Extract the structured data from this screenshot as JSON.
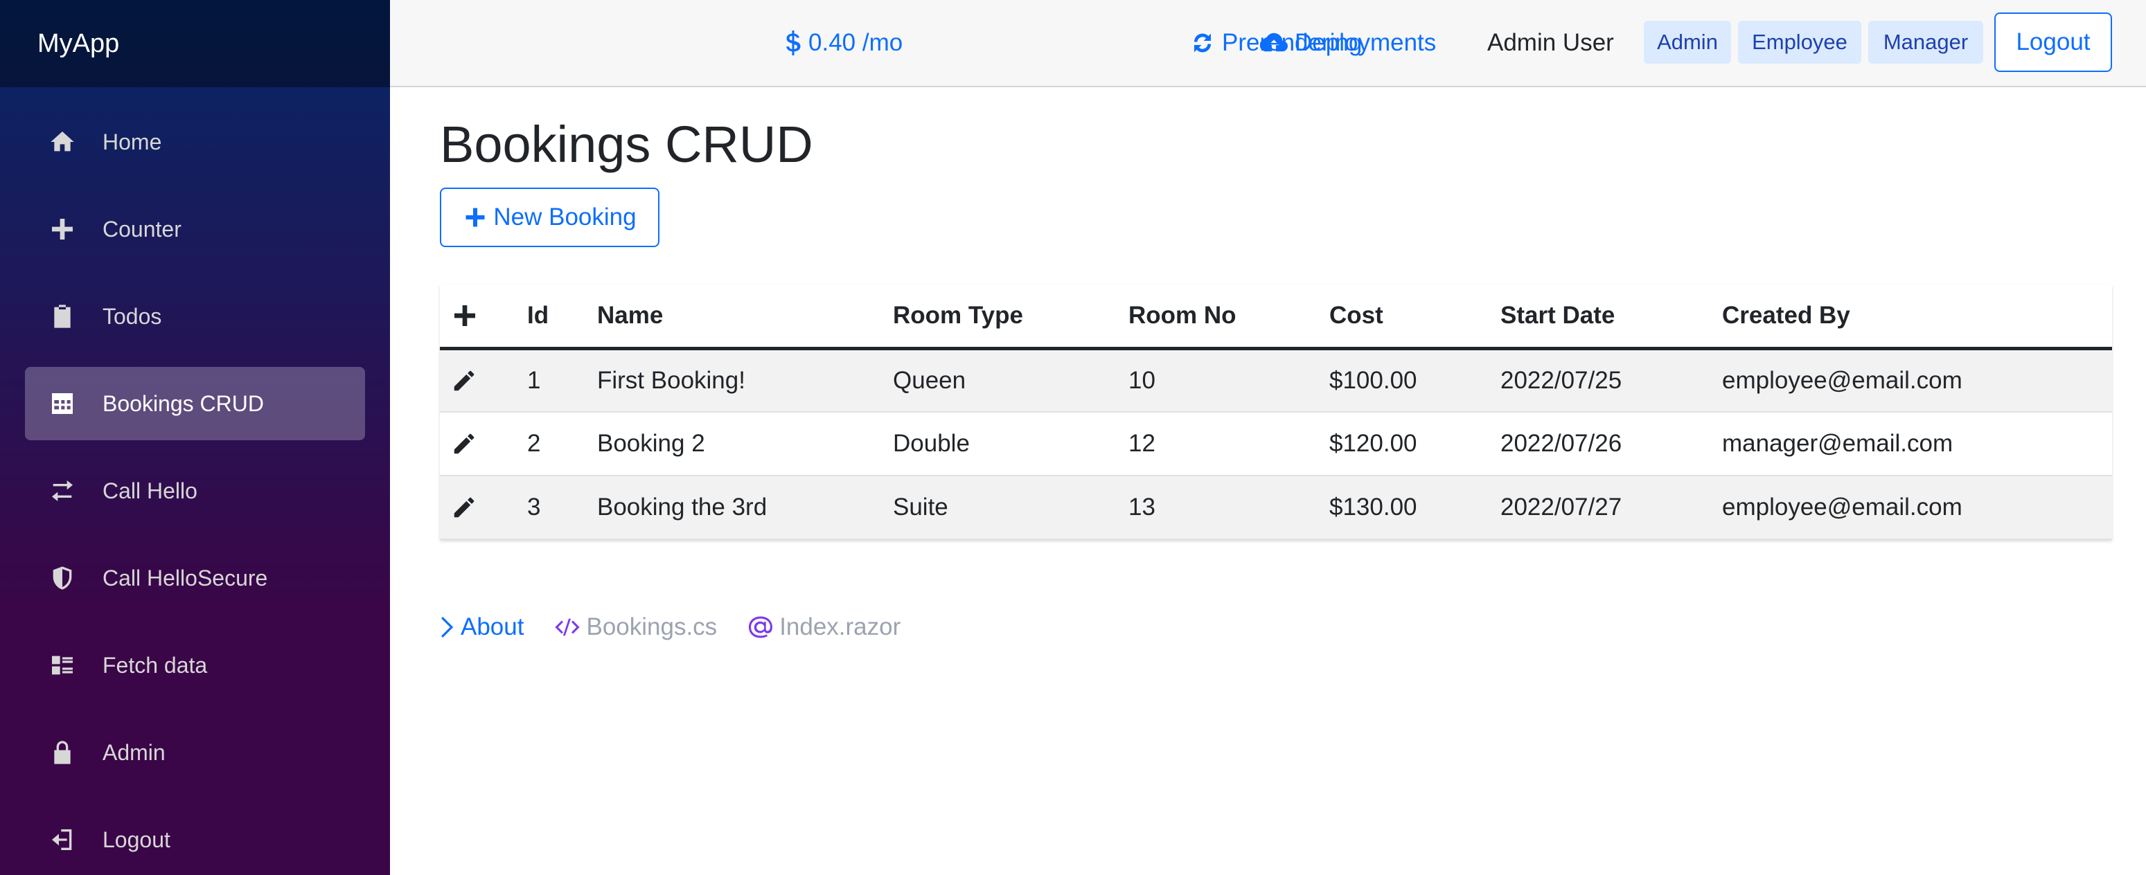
{
  "app": {
    "brand": "MyApp"
  },
  "sidebar": {
    "items": [
      {
        "label": "Home",
        "icon": "home-icon",
        "active": false
      },
      {
        "label": "Counter",
        "icon": "plus-icon",
        "active": false
      },
      {
        "label": "Todos",
        "icon": "clipboard-icon",
        "active": false
      },
      {
        "label": "Bookings CRUD",
        "icon": "table-icon",
        "active": true
      },
      {
        "label": "Call Hello",
        "icon": "swap-icon",
        "active": false
      },
      {
        "label": "Call HelloSecure",
        "icon": "shield-icon",
        "active": false
      },
      {
        "label": "Fetch data",
        "icon": "list-icon",
        "active": false
      },
      {
        "label": "Admin",
        "icon": "lock-icon",
        "active": false
      },
      {
        "label": "Logout",
        "icon": "logout-icon",
        "active": false
      }
    ]
  },
  "topbar": {
    "price": "0.40 /mo",
    "prerendering": "Prerendering",
    "deployments": "Deployments",
    "user": "Admin User",
    "roles": [
      "Admin",
      "Employee",
      "Manager"
    ],
    "logout": "Logout"
  },
  "page": {
    "title": "Bookings CRUD",
    "new_button": "New Booking"
  },
  "table": {
    "columns": [
      "Id",
      "Name",
      "Room Type",
      "Room No",
      "Cost",
      "Start Date",
      "Created By"
    ],
    "rows": [
      [
        "1",
        "First Booking!",
        "Queen",
        "10",
        "$100.00",
        "2022/07/25",
        "employee@email.com"
      ],
      [
        "2",
        "Booking 2",
        "Double",
        "12",
        "$120.00",
        "2022/07/26",
        "manager@email.com"
      ],
      [
        "3",
        "Booking the 3rd",
        "Suite",
        "13",
        "$130.00",
        "2022/07/27",
        "employee@email.com"
      ]
    ]
  },
  "footer": {
    "about": "About",
    "source": "Bookings.cs",
    "razor": "Index.razor"
  },
  "colors": {
    "accent": "#0d6efd",
    "sidebar_top": "#052767",
    "sidebar_bottom": "#3a0647",
    "badge_bg": "#dbeafe"
  }
}
